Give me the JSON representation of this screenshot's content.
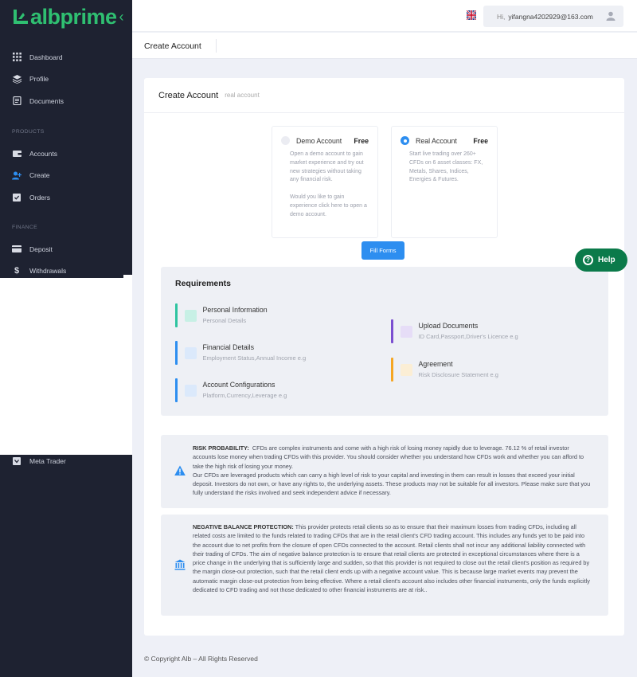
{
  "brand": {
    "logo_text": "albprime"
  },
  "sidebar": {
    "items": [
      {
        "label": "Dashboard",
        "icon": "grid-icon"
      },
      {
        "label": "Profile",
        "icon": "layers-icon"
      },
      {
        "label": "Documents",
        "icon": "document-icon"
      }
    ],
    "products_label": "PRODUCTS",
    "products": [
      {
        "label": "Accounts",
        "icon": "wallet-icon"
      },
      {
        "label": "Create",
        "icon": "add-user-icon"
      },
      {
        "label": "Orders",
        "icon": "clipboard-check-icon"
      }
    ],
    "finance_label": "FINANCE",
    "finance": [
      {
        "label": "Deposit",
        "icon": "credit-card-icon"
      },
      {
        "label": "Withdrawals",
        "icon": "dollar-icon"
      }
    ],
    "bottom_item": {
      "label": "Meta Trader",
      "icon": "download-box-icon"
    }
  },
  "header": {
    "greeting": "Hi,",
    "email": "yifangna4202929@163.com",
    "language_flag": "uk-flag-icon"
  },
  "page": {
    "title": "Create Account"
  },
  "card": {
    "title": "Create Account",
    "subtitle": "real account"
  },
  "accounts": {
    "demo": {
      "name": "Demo Account",
      "price": "Free",
      "desc1": "Open a demo account to gain market experience and try out new strategies without taking any financial risk.",
      "desc2": "Would you like to gain experience click here to open a demo account."
    },
    "real": {
      "name": "Real Account",
      "price": "Free",
      "desc1": "Start live trading over 260+ CFDs on 6 asset classes: FX, Metals, Shares, Indices, Energies & Futures."
    },
    "fill_button": "Fill Forms"
  },
  "requirements": {
    "title": "Requirements",
    "items": [
      {
        "title": "Personal Information",
        "sub": "Personal Details"
      },
      {
        "title": "Financial Details",
        "sub": "Employment Status,Annual Income e.g"
      },
      {
        "title": "Account Configurations",
        "sub": "Platform,Currency,Leverage e.g"
      },
      {
        "title": "Upload Documents",
        "sub": "ID Card,Passport,Driver's Licence e.g"
      },
      {
        "title": "Agreement",
        "sub": "Risk Disclosure Statement e.g"
      }
    ],
    "colors": [
      "#2ec4a0",
      "#2d8ef0",
      "#2d8ef0",
      "#7b4fd0",
      "#f5a623"
    ]
  },
  "notices": {
    "risk_title": "RISK PROBABILITY:",
    "risk_text1": "CFDs are complex instruments and come with a high risk of losing money rapidly due to leverage. 76.12 % of retail investor accounts lose money when trading CFDs with this provider. You should consider whether you understand how CFDs work and whether you can afford to take the high risk of losing your money.",
    "risk_text2": "Our CFDs are leveraged products which can carry a high level of risk to your capital and investing in them can result in losses that exceed your initial deposit. Investors do not own, or have any rights to, the underlying assets. These products may not be suitable for all investors. Please make sure that you fully understand the risks involved and seek independent advice if necessary.",
    "neg_title": "NEGATIVE BALANCE PROTECTION:",
    "neg_text": "This provider protects retail clients so as to ensure that their maximum losses from trading CFDs, including all related costs are limited to the funds related to trading CFDs that are in the retail client's CFD trading account. This includes any funds yet to be paid into the account due to net profits from the closure of open CFDs connected to the account. Retail clients shall not incur any additional liability connected with their trading of CFDs. The aim of negative balance protection is to ensure that retail clients are protected in exceptional circumstances where there is a price change in the underlying that is sufficiently large and sudden, so that this provider is not required to close out the retail client's position as required by the margin close-out protection, such that the retail client ends up with a negative account value. This is because large market events may prevent the automatic margin close-out protection from being effective. Where a retail client's account also includes other financial instruments, only the funds explicitly dedicated to CFD trading and not those dedicated to other financial instruments are at risk.."
  },
  "help_button": "Help",
  "footer": "© Copyright Alb – All Rights Reserved",
  "colors": {
    "accent": "#2d8ef0",
    "brand": "#2fbf71",
    "sidebar": "#1e2231",
    "help": "#0b7a4a"
  }
}
